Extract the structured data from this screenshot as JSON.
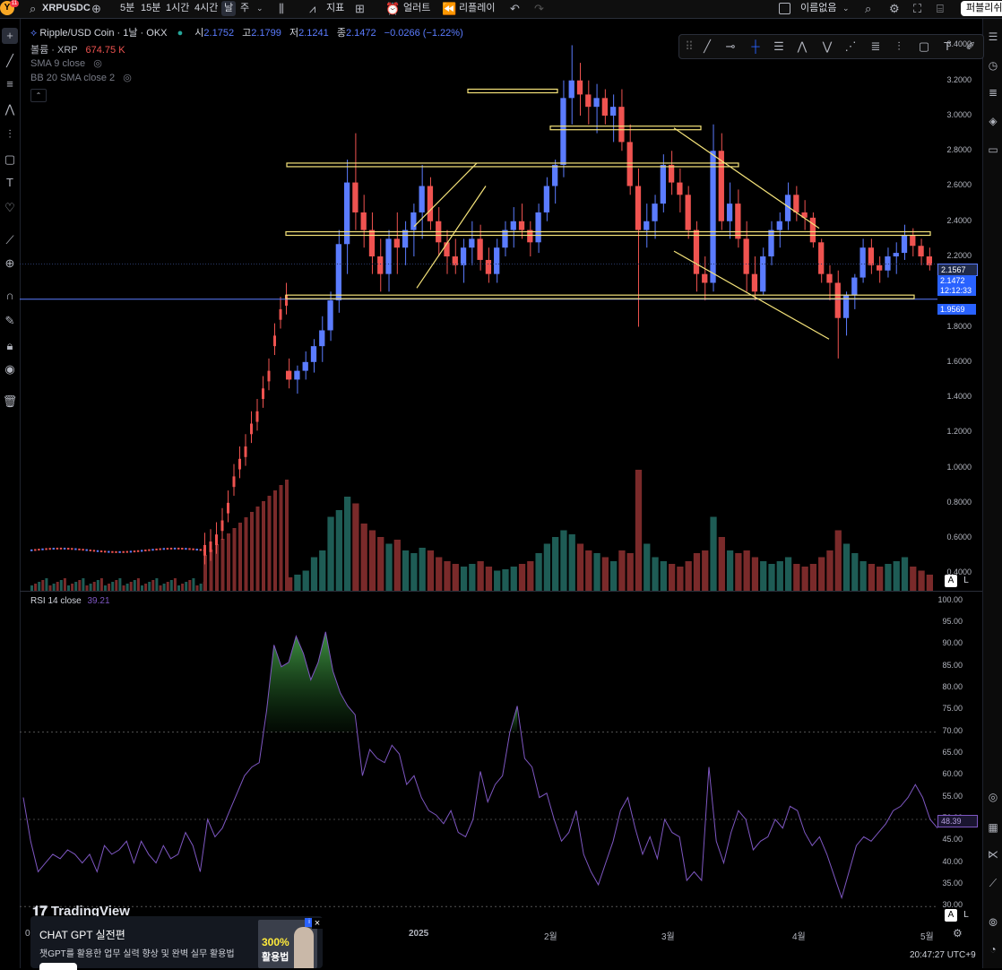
{
  "topbar": {
    "logo": "Y",
    "notif_badge": "11",
    "symbol": "XRPUSDC",
    "intervals": [
      "5분",
      "15분",
      "1시간",
      "4시간",
      "날",
      "주"
    ],
    "active_interval": "날",
    "indicators": "지표",
    "alerts": "얼러트",
    "replay": "리플레이",
    "layout_name": "이름없음",
    "publish": "퍼블리쉬"
  },
  "legend": {
    "title": "Ripple/USD Coin · 1날 · OKX",
    "o_label": "시",
    "o": "2.1752",
    "h_label": "고",
    "h": "2.1799",
    "l_label": "저",
    "l": "2.1241",
    "c_label": "종",
    "c": "2.1472",
    "change": "−0.0266 (−1.22%)",
    "volume_label": "볼륨 · XRP",
    "volume": "674.75 K",
    "sma": "SMA 9 close",
    "bb": "BB 20 SMA close 2"
  },
  "rsi_legend": {
    "label": "RSI 14 close",
    "value": "39.21"
  },
  "price_axis": [
    "3.4000",
    "3.2000",
    "3.0000",
    "2.8000",
    "2.6000",
    "2.4000",
    "2.2000",
    "2.0000",
    "1.8000",
    "1.6000",
    "1.4000",
    "1.2000",
    "1.0000",
    "0.8000",
    "0.6000",
    "0.4000"
  ],
  "price_tags": {
    "sma": "2.1567",
    "last": "2.1472",
    "countdown": "12:12:33",
    "hline": "1.9569"
  },
  "rsi_axis": [
    "100.00",
    "95.00",
    "90.00",
    "85.00",
    "80.00",
    "75.00",
    "70.00",
    "65.00",
    "60.00",
    "55.00",
    "50.00",
    "45.00",
    "40.00",
    "35.00",
    "30.00"
  ],
  "rsi_tag": "48.39",
  "time_axis": [
    "0",
    "2025",
    "2월",
    "3월",
    "4월",
    "5월"
  ],
  "brand": "TradingView",
  "clock": "20:47:27 UTC+9",
  "ad": {
    "title": "CHAT GPT 실전편",
    "subtitle": "챗GPT를 활용한 업무 실력 향상 및 완벽 실무 활용법",
    "badge": "300%",
    "badge_sub": "활용법"
  },
  "colors": {
    "up": "#26a69a",
    "down": "#ef5350",
    "blue": "#5b7cff",
    "yellow": "#f5e37a",
    "rsi": "#7e57c2",
    "bg": "#000000"
  },
  "chart_data": {
    "type": "candlestick",
    "price_ohlc": [
      [
        1.55,
        1.62,
        1.45,
        1.5
      ],
      [
        1.5,
        1.58,
        1.42,
        1.55
      ],
      [
        1.55,
        1.66,
        1.5,
        1.6
      ],
      [
        1.6,
        1.73,
        1.54,
        1.69
      ],
      [
        1.69,
        1.86,
        1.6,
        1.78
      ],
      [
        1.78,
        2.0,
        1.72,
        1.95
      ],
      [
        1.95,
        2.35,
        1.88,
        2.27
      ],
      [
        2.27,
        2.75,
        2.1,
        2.62
      ],
      [
        2.62,
        2.9,
        2.35,
        2.45
      ],
      [
        2.45,
        2.55,
        2.25,
        2.35
      ],
      [
        2.35,
        2.45,
        2.1,
        2.2
      ],
      [
        2.2,
        2.3,
        2.0,
        2.1
      ],
      [
        2.1,
        2.35,
        2.0,
        2.3
      ],
      [
        2.3,
        2.45,
        2.1,
        2.25
      ],
      [
        2.25,
        2.4,
        2.15,
        2.35
      ],
      [
        2.35,
        2.5,
        2.2,
        2.45
      ],
      [
        2.45,
        2.72,
        2.3,
        2.6
      ],
      [
        2.6,
        2.65,
        2.35,
        2.4
      ],
      [
        2.4,
        2.48,
        2.2,
        2.28
      ],
      [
        2.28,
        2.35,
        2.1,
        2.2
      ],
      [
        2.2,
        2.3,
        2.1,
        2.15
      ],
      [
        2.15,
        2.3,
        2.05,
        2.25
      ],
      [
        2.25,
        2.4,
        2.15,
        2.3
      ],
      [
        2.3,
        2.38,
        2.12,
        2.18
      ],
      [
        2.18,
        2.25,
        2.05,
        2.1
      ],
      [
        2.1,
        2.3,
        2.05,
        2.25
      ],
      [
        2.25,
        2.4,
        2.2,
        2.35
      ],
      [
        2.35,
        2.48,
        2.25,
        2.4
      ],
      [
        2.4,
        2.5,
        2.3,
        2.35
      ],
      [
        2.35,
        2.4,
        2.2,
        2.28
      ],
      [
        2.28,
        2.5,
        2.22,
        2.45
      ],
      [
        2.45,
        2.65,
        2.4,
        2.6
      ],
      [
        2.6,
        2.75,
        2.5,
        2.72
      ],
      [
        2.72,
        3.2,
        2.65,
        3.1
      ],
      [
        3.1,
        3.4,
        2.95,
        3.2
      ],
      [
        3.2,
        3.3,
        3.0,
        3.12
      ],
      [
        3.12,
        3.2,
        2.95,
        3.05
      ],
      [
        3.05,
        3.18,
        2.9,
        3.1
      ],
      [
        3.1,
        3.15,
        2.95,
        3.0
      ],
      [
        3.0,
        3.12,
        2.85,
        3.05
      ],
      [
        3.05,
        3.15,
        2.8,
        2.85
      ],
      [
        2.85,
        2.95,
        2.55,
        2.6
      ],
      [
        2.6,
        2.7,
        1.8,
        2.35
      ],
      [
        2.35,
        2.5,
        2.25,
        2.4
      ],
      [
        2.4,
        2.55,
        2.3,
        2.5
      ],
      [
        2.5,
        2.78,
        2.45,
        2.72
      ],
      [
        2.72,
        2.8,
        2.55,
        2.62
      ],
      [
        2.62,
        2.7,
        2.45,
        2.55
      ],
      [
        2.55,
        2.6,
        2.3,
        2.35
      ],
      [
        2.35,
        2.4,
        2.0,
        2.1
      ],
      [
        2.1,
        2.2,
        1.95,
        2.05
      ],
      [
        2.05,
        2.95,
        2.0,
        2.8
      ],
      [
        2.8,
        2.9,
        2.35,
        2.4
      ],
      [
        2.4,
        2.62,
        2.3,
        2.5
      ],
      [
        2.5,
        2.58,
        2.25,
        2.3
      ],
      [
        2.3,
        2.4,
        2.0,
        2.1
      ],
      [
        2.1,
        2.2,
        1.95,
        2.0
      ],
      [
        2.0,
        2.25,
        1.98,
        2.2
      ],
      [
        2.2,
        2.4,
        2.15,
        2.35
      ],
      [
        2.35,
        2.45,
        2.25,
        2.4
      ],
      [
        2.4,
        2.62,
        2.35,
        2.55
      ],
      [
        2.55,
        2.6,
        2.4,
        2.45
      ],
      [
        2.45,
        2.52,
        2.35,
        2.42
      ],
      [
        2.42,
        2.45,
        2.25,
        2.28
      ],
      [
        2.28,
        2.3,
        2.05,
        2.1
      ],
      [
        2.1,
        2.15,
        1.95,
        2.05
      ],
      [
        2.05,
        2.12,
        1.62,
        1.85
      ],
      [
        1.85,
        2.0,
        1.75,
        1.98
      ],
      [
        1.98,
        2.1,
        1.9,
        2.08
      ],
      [
        2.08,
        2.3,
        2.05,
        2.25
      ],
      [
        2.25,
        2.3,
        2.1,
        2.15
      ],
      [
        2.15,
        2.2,
        2.05,
        2.12
      ],
      [
        2.12,
        2.25,
        2.08,
        2.2
      ],
      [
        2.2,
        2.28,
        2.1,
        2.22
      ],
      [
        2.22,
        2.38,
        2.18,
        2.32
      ],
      [
        2.32,
        2.36,
        2.2,
        2.26
      ],
      [
        2.26,
        2.3,
        2.15,
        2.2
      ],
      [
        2.2,
        2.25,
        2.12,
        2.15
      ]
    ],
    "volume": [
      0.1,
      0.12,
      0.15,
      0.25,
      0.3,
      0.55,
      0.6,
      0.7,
      0.65,
      0.5,
      0.45,
      0.4,
      0.35,
      0.38,
      0.3,
      0.28,
      0.32,
      0.3,
      0.25,
      0.22,
      0.2,
      0.18,
      0.2,
      0.22,
      0.18,
      0.15,
      0.16,
      0.18,
      0.2,
      0.22,
      0.28,
      0.35,
      0.4,
      0.45,
      0.42,
      0.35,
      0.3,
      0.28,
      0.25,
      0.22,
      0.3,
      0.28,
      0.9,
      0.35,
      0.25,
      0.22,
      0.2,
      0.18,
      0.22,
      0.28,
      0.3,
      0.55,
      0.4,
      0.3,
      0.28,
      0.3,
      0.25,
      0.22,
      0.2,
      0.22,
      0.25,
      0.2,
      0.18,
      0.2,
      0.25,
      0.3,
      0.45,
      0.35,
      0.28,
      0.22,
      0.2,
      0.18,
      0.2,
      0.22,
      0.25,
      0.18,
      0.15,
      0.12
    ],
    "rsi": [
      55,
      45,
      38,
      40,
      42,
      41,
      43,
      42,
      40,
      42,
      38,
      44,
      42,
      43,
      45,
      40,
      45,
      42,
      40,
      44,
      41,
      42,
      47,
      44,
      38,
      50,
      46,
      48,
      52,
      56,
      60,
      62,
      63,
      75,
      90,
      85,
      86,
      92,
      88,
      82,
      86,
      93,
      84,
      79,
      76,
      74,
      60,
      66,
      64,
      63,
      67,
      65,
      58,
      60,
      55,
      52,
      51,
      49,
      52,
      47,
      46,
      50,
      61,
      54,
      58,
      60,
      70,
      76,
      64,
      62,
      55,
      56,
      50,
      45,
      47,
      52,
      42,
      38,
      35,
      40,
      45,
      52,
      55,
      48,
      42,
      46,
      41,
      50,
      47,
      46,
      36,
      38,
      36,
      62,
      45,
      40,
      47,
      52,
      50,
      43,
      45,
      46,
      50,
      48,
      53,
      52,
      47,
      44,
      46,
      42,
      37,
      32,
      38,
      44,
      46,
      45,
      47,
      49,
      52,
      53,
      55,
      58,
      55,
      50,
      48
    ]
  }
}
